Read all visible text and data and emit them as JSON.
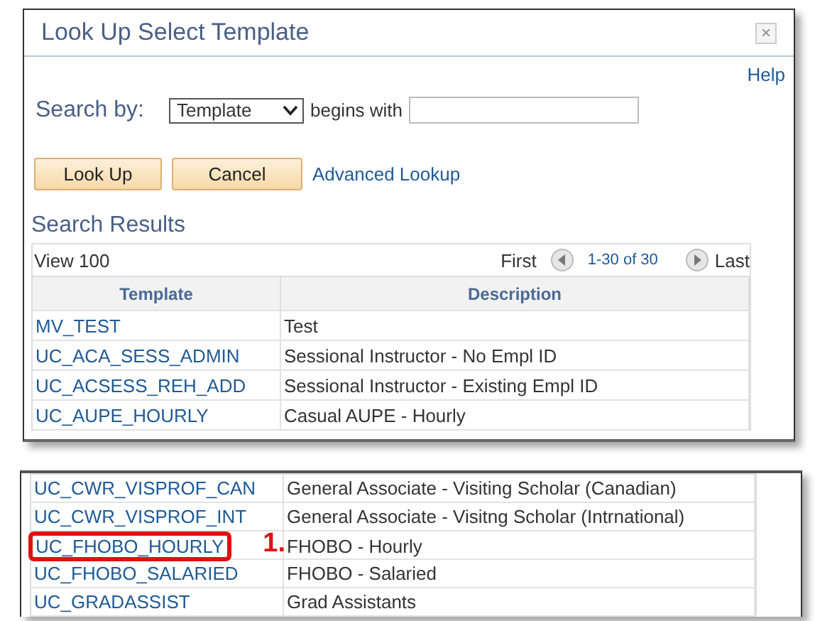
{
  "window": {
    "title": "Look Up Select Template",
    "close": "×"
  },
  "help": "Help",
  "search": {
    "label": "Search by:",
    "field": "Template",
    "operator": "begins with"
  },
  "buttons": [
    {
      "label": "Look Up",
      "kind": "button"
    },
    {
      "label": "Cancel",
      "kind": "button"
    },
    {
      "label": "Advanced Lookup",
      "kind": "link"
    }
  ],
  "results": {
    "title": "Search Results",
    "view": "View 100",
    "first": "First",
    "range": "1-30 of 30",
    "last": "Last",
    "columns": [
      "Template",
      "Description"
    ],
    "rows": [
      {
        "template": "MV_TEST",
        "description": "Test"
      },
      {
        "template": "UC_ACA_SESS_ADMIN",
        "description": "Sessional Instructor - No Empl ID"
      },
      {
        "template": "UC_ACSESS_REH_ADD",
        "description": "Sessional Instructor - Existing Empl ID"
      },
      {
        "template": "UC_AUPE_HOURLY",
        "description": "Casual AUPE - Hourly"
      }
    ]
  },
  "continued_rows": [
    {
      "template": "UC_CWR_VISPROF_CAN",
      "description": "General Associate - Visiting Scholar (Canadian)",
      "highlighted": false
    },
    {
      "template": "UC_CWR_VISPROF_INT",
      "description": "General Associate - Visitng Scholar (Intrnational)",
      "highlighted": false
    },
    {
      "template": "UC_FHOBO_HOURLY",
      "description": "FHOBO - Hourly",
      "highlighted": true,
      "callout": "1."
    },
    {
      "template": "UC_FHOBO_SALARIED",
      "description": "FHOBO - Salaried",
      "highlighted": false
    },
    {
      "template": "UC_GRADASSIST",
      "description": "Grad Assistants",
      "highlighted": false
    }
  ]
}
